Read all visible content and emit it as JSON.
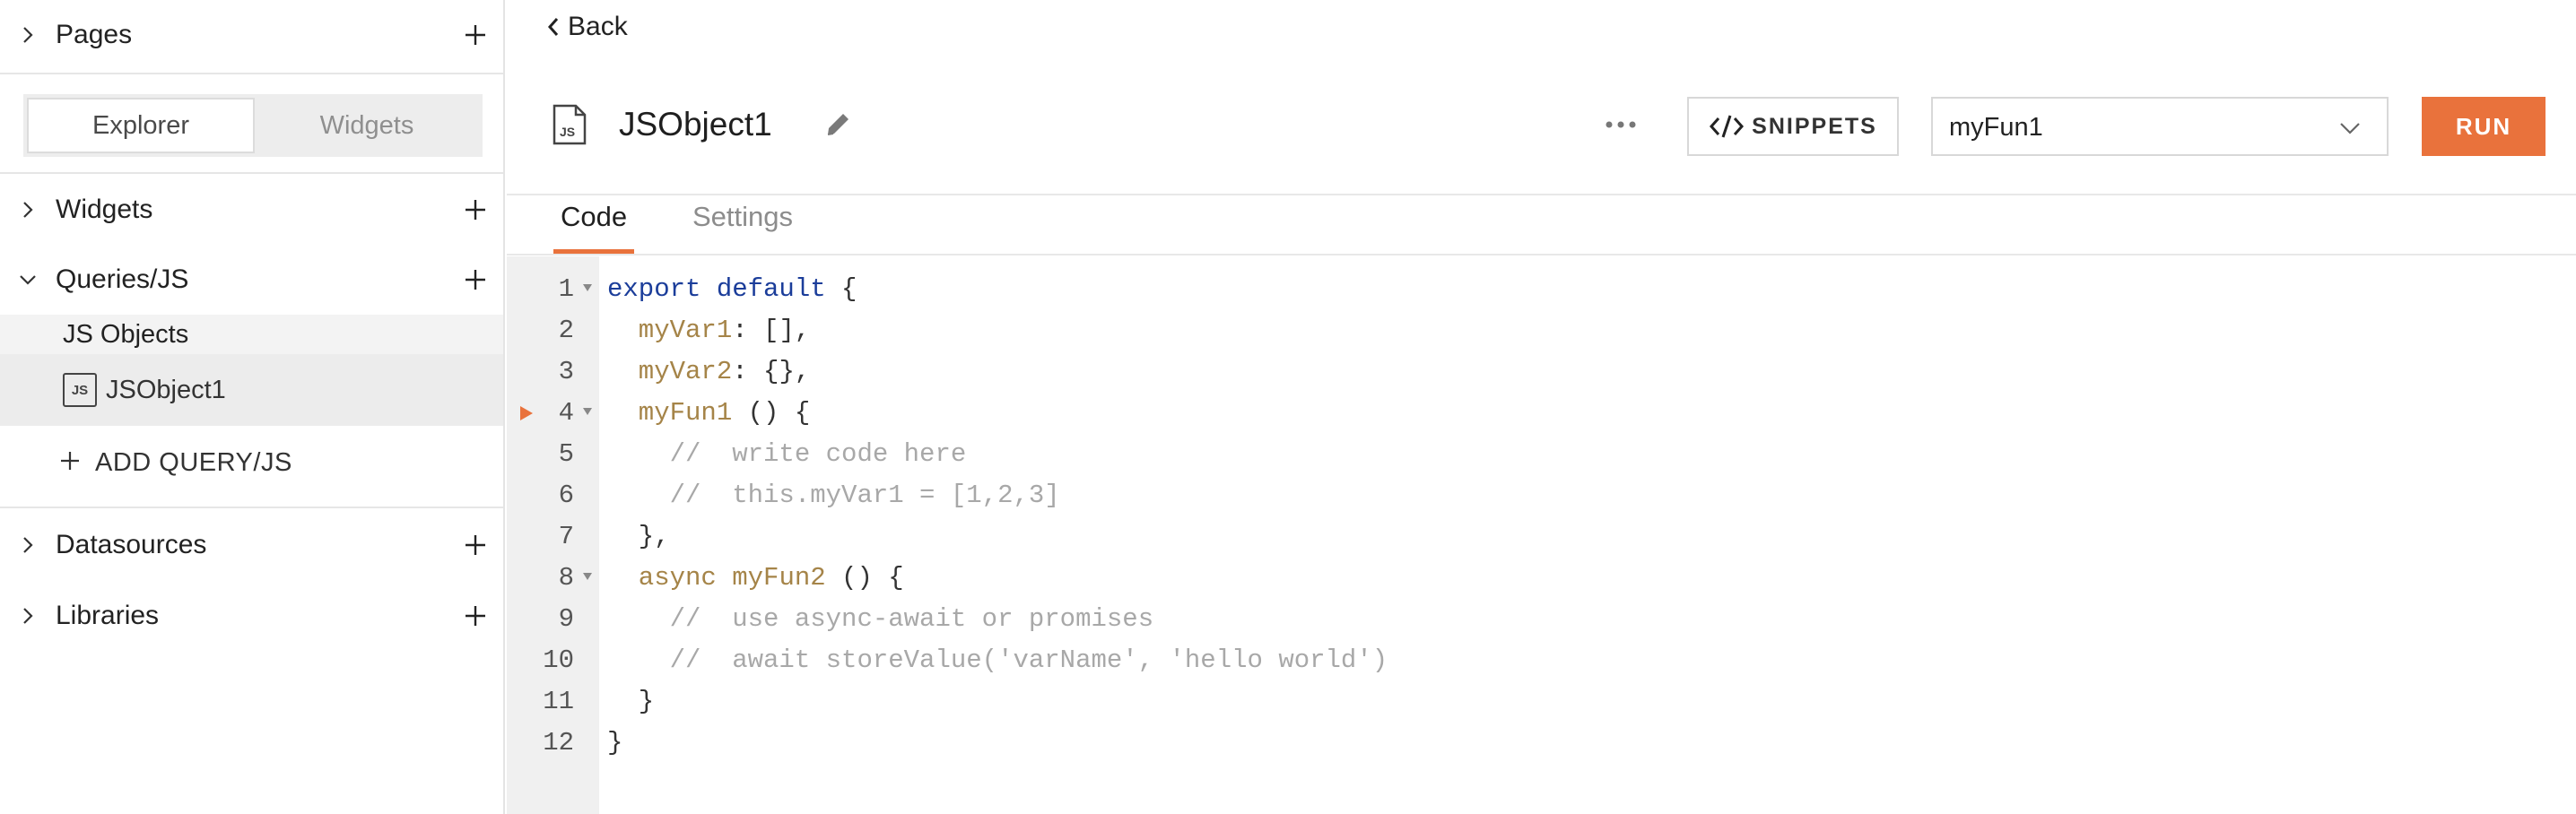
{
  "sidebar": {
    "pages": {
      "label": "Pages"
    },
    "tabs": [
      {
        "label": "Explorer",
        "active": true
      },
      {
        "label": "Widgets",
        "active": false
      }
    ],
    "widgets": {
      "label": "Widgets"
    },
    "queries": {
      "label": "Queries/JS",
      "expanded": true
    },
    "js_objects_group": "JS Objects",
    "js_badge": "JS",
    "selected_item": "JSObject1",
    "add_label": "ADD QUERY/JS",
    "datasources": {
      "label": "Datasources"
    },
    "libraries": {
      "label": "Libraries"
    }
  },
  "main": {
    "back_label": "Back",
    "title": "JSObject1",
    "file_badge": "JS",
    "snippets_label": "SNIPPETS",
    "function_select": {
      "value": "myFun1"
    },
    "run_label": "RUN",
    "tabs": [
      {
        "label": "Code",
        "active": true
      },
      {
        "label": "Settings",
        "active": false
      }
    ]
  },
  "editor": {
    "lines": [
      {
        "n": "1",
        "fold": true,
        "run": false,
        "tokens": [
          {
            "t": "export default",
            "c": "kw"
          },
          {
            "t": " {",
            "c": "pn"
          }
        ]
      },
      {
        "n": "2",
        "fold": false,
        "run": false,
        "tokens": [
          {
            "t": "  myVar1",
            "c": "prop"
          },
          {
            "t": ": [],",
            "c": "pn"
          }
        ]
      },
      {
        "n": "3",
        "fold": false,
        "run": false,
        "tokens": [
          {
            "t": "  myVar2",
            "c": "prop"
          },
          {
            "t": ": {},",
            "c": "pn"
          }
        ]
      },
      {
        "n": "4",
        "fold": true,
        "run": true,
        "tokens": [
          {
            "t": "  myFun1",
            "c": "prop"
          },
          {
            "t": " () {",
            "c": "pn"
          }
        ]
      },
      {
        "n": "5",
        "fold": false,
        "run": false,
        "tokens": [
          {
            "t": "    //  write code here",
            "c": "cm"
          }
        ]
      },
      {
        "n": "6",
        "fold": false,
        "run": false,
        "tokens": [
          {
            "t": "    //  this.myVar1 = [1,2,3]",
            "c": "cm"
          }
        ]
      },
      {
        "n": "7",
        "fold": false,
        "run": false,
        "tokens": [
          {
            "t": "  },",
            "c": "pn"
          }
        ]
      },
      {
        "n": "8",
        "fold": true,
        "run": false,
        "tokens": [
          {
            "t": "  async ",
            "c": "prop"
          },
          {
            "t": "myFun2",
            "c": "prop"
          },
          {
            "t": " () {",
            "c": "pn"
          }
        ]
      },
      {
        "n": "9",
        "fold": false,
        "run": false,
        "tokens": [
          {
            "t": "    //  use async-await or promises",
            "c": "cm"
          }
        ]
      },
      {
        "n": "10",
        "fold": false,
        "run": false,
        "tokens": [
          {
            "t": "    //  await storeValue('varName', 'hello world')",
            "c": "cm"
          }
        ]
      },
      {
        "n": "11",
        "fold": false,
        "run": false,
        "tokens": [
          {
            "t": "  }",
            "c": "pn"
          }
        ]
      },
      {
        "n": "12",
        "fold": false,
        "run": false,
        "tokens": [
          {
            "t": "}",
            "c": "pn"
          }
        ]
      }
    ]
  },
  "colors": {
    "accent": "#e9723c",
    "keyword": "#1b3d9a",
    "property": "#a58448",
    "comment": "#a8a8a8"
  }
}
